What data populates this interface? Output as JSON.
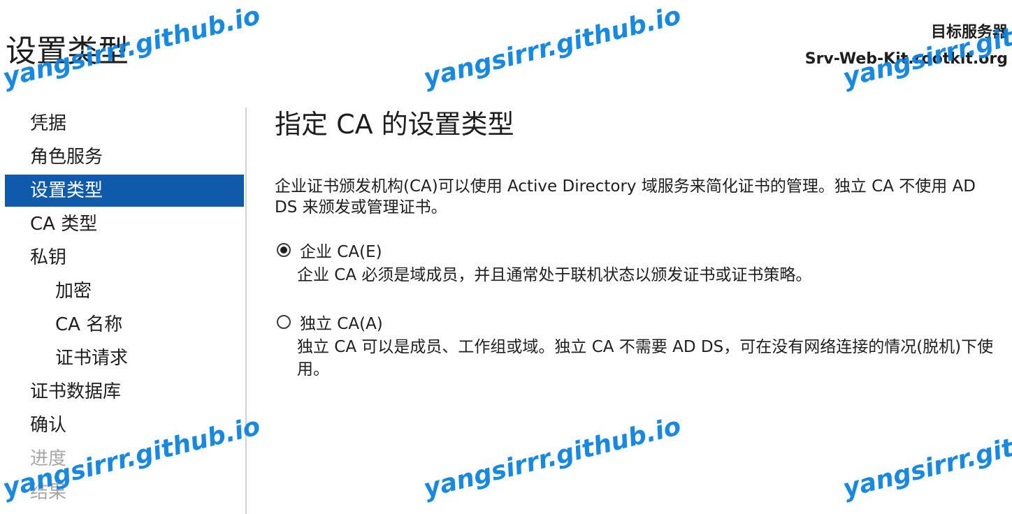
{
  "page": {
    "title": "设置类型"
  },
  "target_server": {
    "label": "目标服务器",
    "name": "Srv-Web-Kit.rootkit.org"
  },
  "nav": {
    "items": [
      {
        "label": "凭据",
        "level": 1,
        "state": "normal"
      },
      {
        "label": "角色服务",
        "level": 1,
        "state": "normal"
      },
      {
        "label": "设置类型",
        "level": 1,
        "state": "active"
      },
      {
        "label": "CA 类型",
        "level": 1,
        "state": "normal"
      },
      {
        "label": "私钥",
        "level": 1,
        "state": "normal"
      },
      {
        "label": "加密",
        "level": 2,
        "state": "normal"
      },
      {
        "label": "CA 名称",
        "level": 2,
        "state": "normal"
      },
      {
        "label": "证书请求",
        "level": 2,
        "state": "normal"
      },
      {
        "label": "证书数据库",
        "level": 1,
        "state": "normal"
      },
      {
        "label": "确认",
        "level": 1,
        "state": "normal"
      },
      {
        "label": "进度",
        "level": 1,
        "state": "disabled"
      },
      {
        "label": "结果",
        "level": 1,
        "state": "disabled"
      }
    ]
  },
  "main": {
    "heading": "指定 CA 的设置类型",
    "description": "企业证书颁发机构(CA)可以使用 Active Directory 域服务来简化证书的管理。独立 CA 不使用 AD DS 来颁发或管理证书。",
    "options": [
      {
        "label": "企业 CA(E)",
        "checked": true,
        "description": "企业 CA 必须是域成员，并且通常处于联机状态以颁发证书或证书策略。"
      },
      {
        "label": "独立 CA(A)",
        "checked": false,
        "description": "独立 CA 可以是成员、工作组或域。独立 CA 不需要 AD DS，可在没有网络连接的情况(脱机)下使用。"
      }
    ]
  },
  "watermark": {
    "text": "yangsirrr.github.io",
    "color": "#0d82e0"
  },
  "colors": {
    "accent": "#0f5aab",
    "disabled_text": "#a8a8a8",
    "divider": "#d2d2d2"
  }
}
